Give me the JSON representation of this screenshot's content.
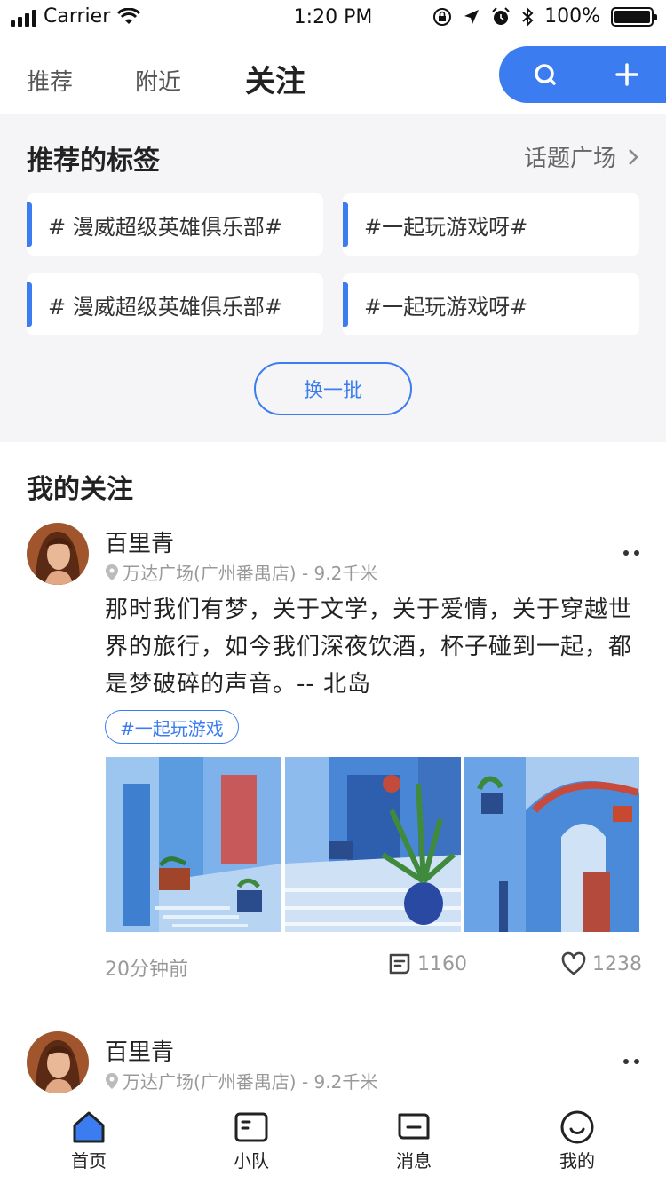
{
  "status_bar": {
    "carrier": "Carrier",
    "time": "1:20 PM",
    "battery": "100%",
    "battery_level": 1.0,
    "icons": [
      "signal-icon",
      "wifi-icon",
      "rotation-lock-icon",
      "location-arrow-icon",
      "alarm-icon",
      "bluetooth-icon",
      "battery-icon"
    ]
  },
  "top_nav": {
    "tabs": [
      {
        "label": "推荐",
        "active": false
      },
      {
        "label": "附近",
        "active": false
      },
      {
        "label": "关注",
        "active": true
      }
    ],
    "actions": [
      "search-icon",
      "plus-icon"
    ],
    "accent_color": "#3b7cf0"
  },
  "recommended_tags": {
    "title": "推荐的标签",
    "link_label": "话题广场",
    "tags": [
      "# 漫威超级英雄俱乐部#",
      "#一起玩游戏呀#",
      "# 漫威超级英雄俱乐部#",
      "#一起玩游戏呀#"
    ],
    "refresh_label": "换一批"
  },
  "following": {
    "title": "我的关注",
    "posts": [
      {
        "user_name": "百里青",
        "location": "万达广场(广州番禺店) - 9.2千米",
        "text": "那时我们有梦，关于文学，关于爱情，关于穿越世界的旅行，如今我们深夜饮酒，杯子碰到一起，都是梦破碎的声音。-- 北岛",
        "tag": "#一起玩游戏",
        "time_ago": "20分钟前",
        "comments": "1160",
        "likes": "1238"
      },
      {
        "user_name": "百里青",
        "location": "万达广场(广州番禺店) - 9.2千米"
      }
    ]
  },
  "tab_bar": {
    "items": [
      {
        "label": "首页",
        "icon": "home-icon",
        "active": true
      },
      {
        "label": "小队",
        "icon": "team-icon",
        "active": false
      },
      {
        "label": "消息",
        "icon": "message-icon",
        "active": false
      },
      {
        "label": "我的",
        "icon": "profile-icon",
        "active": false
      }
    ]
  }
}
